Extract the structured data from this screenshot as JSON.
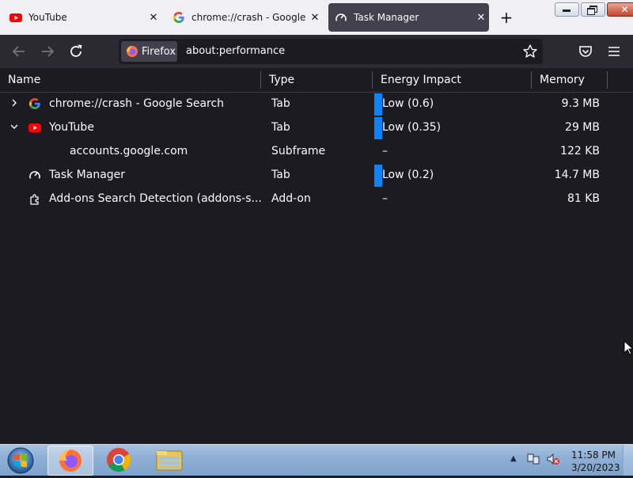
{
  "tabs": [
    {
      "title": "YouTube",
      "icon": "youtube-icon"
    },
    {
      "title": "chrome://crash - Google Search",
      "icon": "google-icon"
    },
    {
      "title": "Task Manager",
      "icon": "gauge-icon",
      "active": true
    }
  ],
  "nav": {
    "identity_label": "Firefox",
    "url": "about:performance"
  },
  "table": {
    "columns": [
      "Name",
      "Type",
      "Energy Impact",
      "Memory"
    ],
    "rows": [
      {
        "name": "chrome://crash - Google Search",
        "type": "Tab",
        "energy": "Low (0.6)",
        "memory": "9.3 MB",
        "icon": "google-icon",
        "twisty": "collapsed"
      },
      {
        "name": "YouTube",
        "type": "Tab",
        "energy": "Low (0.35)",
        "memory": "29 MB",
        "icon": "youtube-icon",
        "twisty": "expanded"
      },
      {
        "name": "accounts.google.com",
        "type": "Subframe",
        "energy": "–",
        "memory": "122 KB",
        "icon": "",
        "twisty": "none"
      },
      {
        "name": "Task Manager",
        "type": "Tab",
        "energy": "Low (0.2)",
        "memory": "14.7 MB",
        "icon": "gauge-icon",
        "twisty": "none"
      },
      {
        "name": "Add-ons Search Detection (addons-s...",
        "type": "Add-on",
        "energy": "–",
        "memory": "81 KB",
        "icon": "puzzle-icon",
        "twisty": "none"
      }
    ]
  },
  "taskbar": {
    "apps": [
      "firefox-icon",
      "chrome-icon",
      "file-explorer-icon"
    ],
    "time": "11:58 PM",
    "date": "3/20/2023"
  },
  "colors": {
    "accent": "#0a84ff",
    "background": "#1c1b22",
    "toolbar": "#2b2a33",
    "active_tab": "#42414d"
  }
}
